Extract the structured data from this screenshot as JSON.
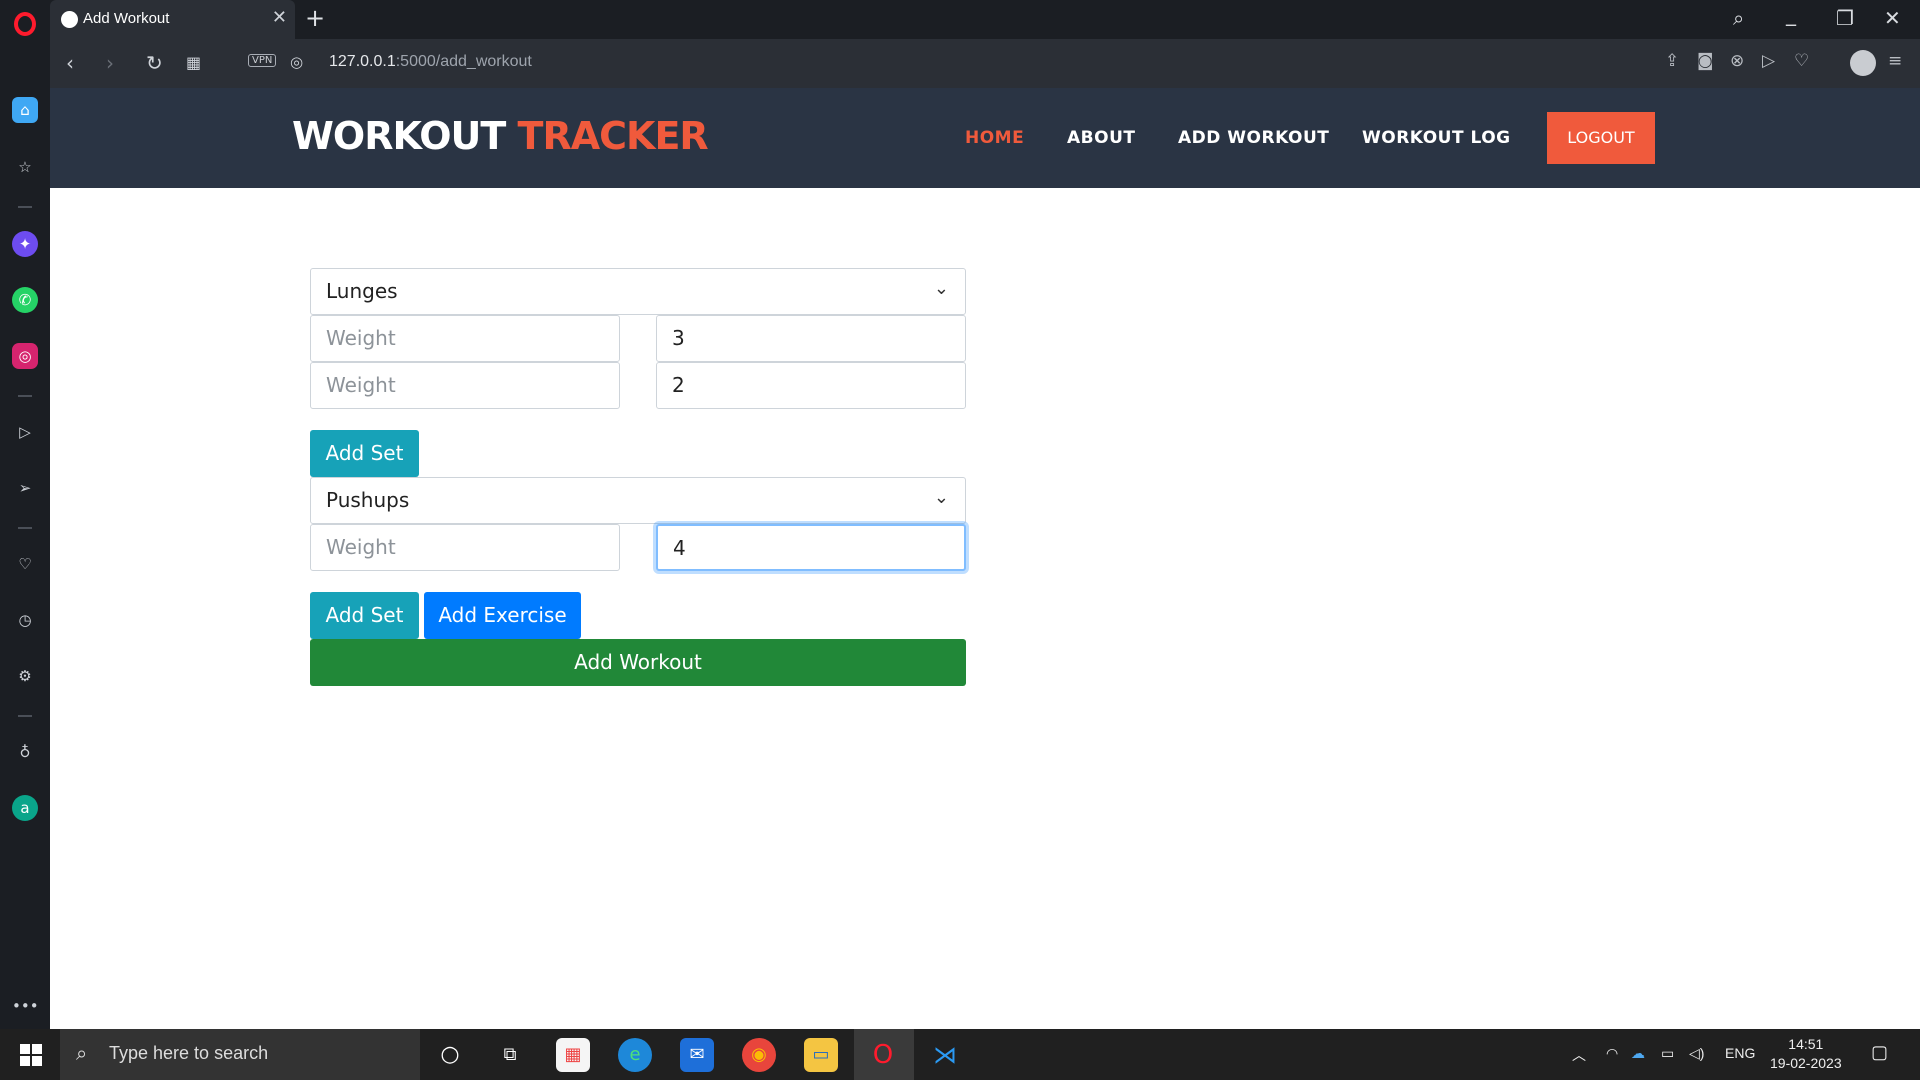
{
  "browser": {
    "tab_title": "Add Workout",
    "tab_close": "✕",
    "new_tab": "+",
    "url_host": "127.0.0.1",
    "url_path": ":5000/add_workout",
    "vpn_label": "VPN"
  },
  "site": {
    "brand_main": "WORKOUT",
    "brand_accent": "TRACKER",
    "nav": {
      "home": "HOME",
      "about": "ABOUT",
      "add_workout": "ADD WORKOUT",
      "workout_log": "WORKOUT LOG",
      "logout": "LOGOUT"
    },
    "colors": {
      "header_bg": "#2a3444",
      "accent": "#f05a3c",
      "teal_button": "#17a2b8",
      "blue_button": "#007bff",
      "green_button": "#218838"
    }
  },
  "form": {
    "exercise1": {
      "selected": "Lunges",
      "sets": [
        {
          "weight_placeholder": "Weight",
          "reps_value": "3"
        },
        {
          "weight_placeholder": "Weight",
          "reps_value": "2"
        }
      ],
      "add_set_label": "Add Set"
    },
    "exercise2": {
      "selected": "Pushups",
      "sets": [
        {
          "weight_placeholder": "Weight",
          "reps_value": "4"
        }
      ],
      "add_set_label": "Add Set"
    },
    "add_exercise_label": "Add Exercise",
    "add_workout_label": "Add Workout"
  },
  "taskbar": {
    "search_placeholder": "Type here to search",
    "language": "ENG",
    "time": "14:51",
    "date": "19-02-2023"
  }
}
